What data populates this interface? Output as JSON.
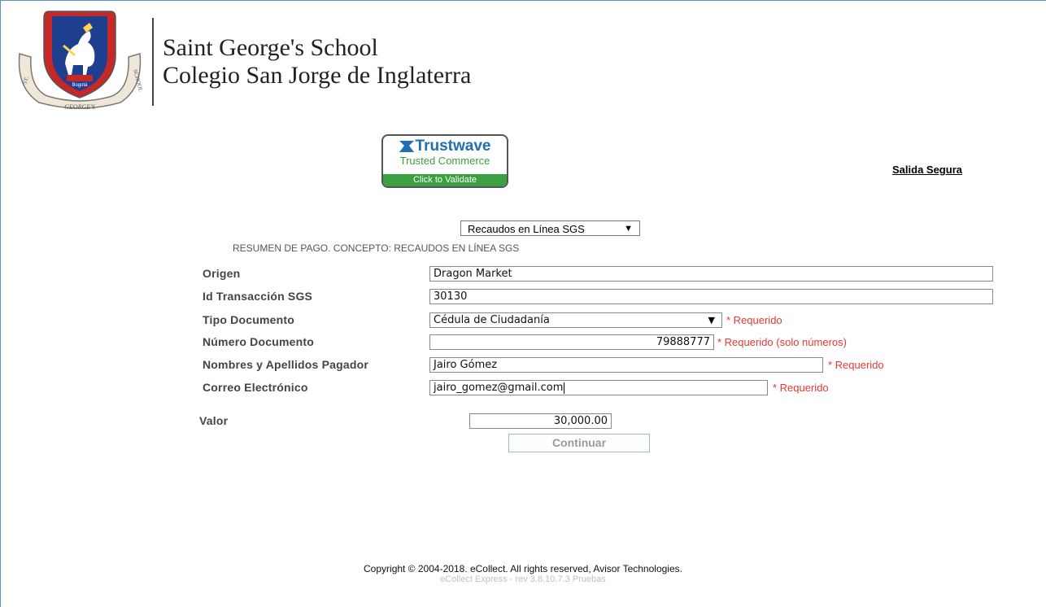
{
  "header": {
    "school_name_en": "Saint George's School",
    "school_name_es": "Colegio San Jorge de Inglaterra",
    "logo_text": "ST. GEORGE'S SCHOOL",
    "logo_city": "Bogotá"
  },
  "badge": {
    "brand": "Trustwave",
    "line1": "Trusted Commerce",
    "line2": "Click to Validate",
    "brand_color": "#1f6fb2",
    "green": "#3ba03f"
  },
  "nav": {
    "logout_label": "Salida Segura"
  },
  "concept": {
    "selected": "Recaudos en Línea SGS"
  },
  "summary": {
    "text": "RESUMEN DE PAGO. CONCEPTO: RECAUDOS EN LÍNEA SGS"
  },
  "form": {
    "origen": {
      "label": "Origen",
      "value": "Dragon Market"
    },
    "id_transaccion": {
      "label": "Id Transacción SGS",
      "value": "30130"
    },
    "tipo_documento": {
      "label": "Tipo Documento",
      "value": "Cédula de Ciudadanía",
      "required": "* Requerido"
    },
    "numero_documento": {
      "label": "Número Documento",
      "value": "79888777",
      "required": "* Requerido (solo números)"
    },
    "nombres": {
      "label": "Nombres y Apellidos Pagador",
      "value": "Jairo Gómez",
      "required": "* Requerido"
    },
    "correo": {
      "label": "Correo Electrónico",
      "value": "jairo_gomez@gmail.com",
      "required": "* Requerido"
    },
    "valor": {
      "label": "Valor",
      "value": "30,000.00"
    },
    "submit_label": "Continuar"
  },
  "footer": {
    "copyright": "Copyright © 2004-2018. eCollect. All rights reserved, Avisor Technologies.",
    "version": "eCollect Express - rev 3.8.10.7.3 Pruebas"
  },
  "colors": {
    "required": "#e53935",
    "frame": "#5b8ccc"
  }
}
